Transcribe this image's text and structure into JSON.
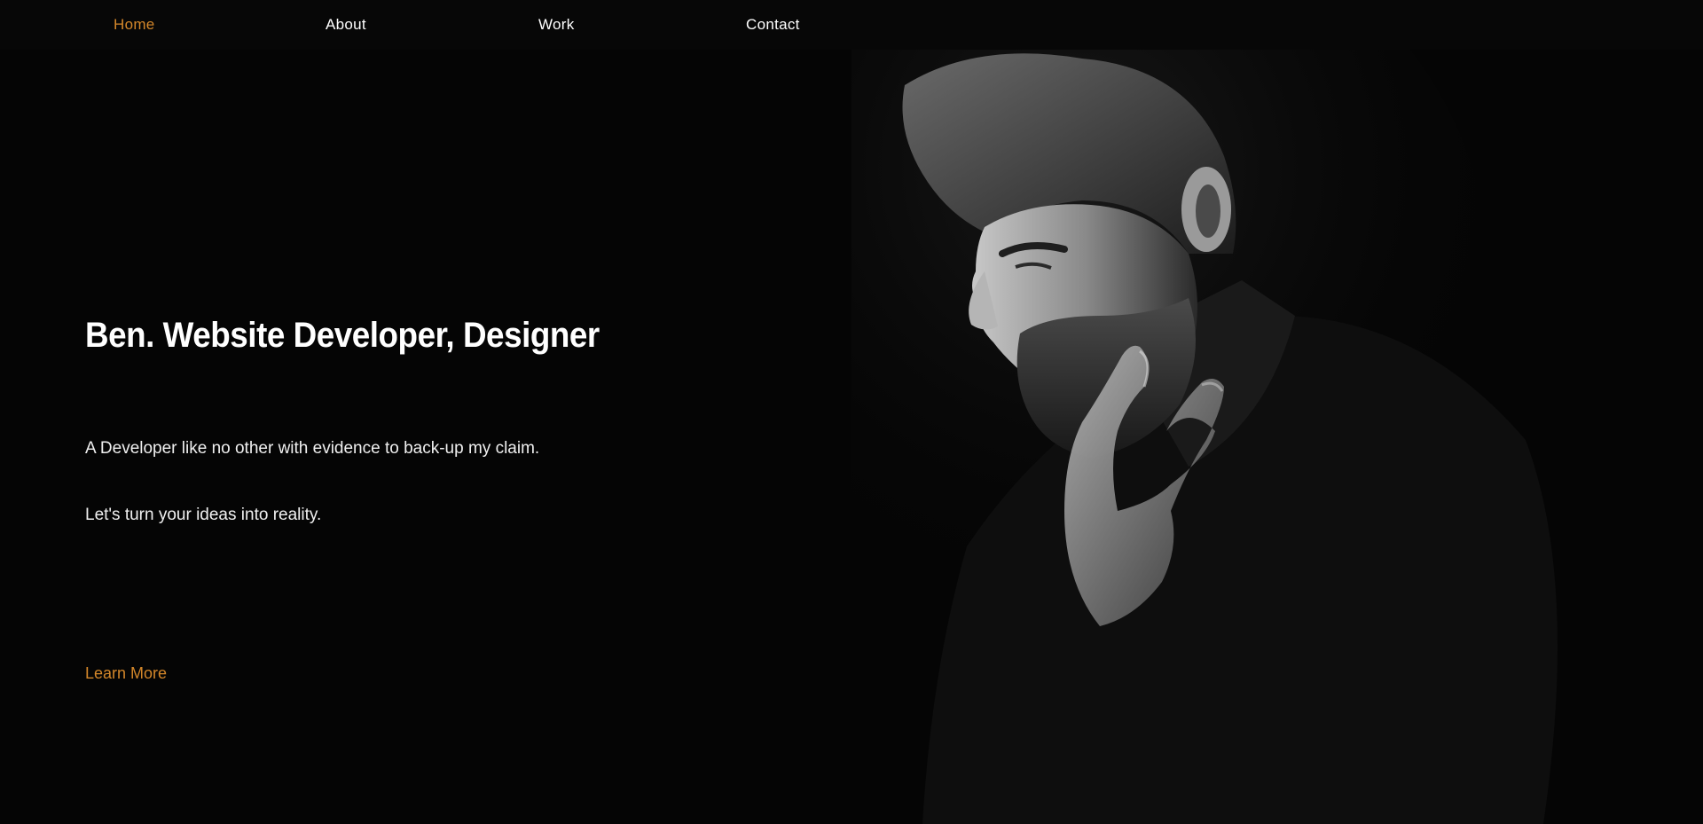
{
  "nav": {
    "items": [
      {
        "label": "Home",
        "active": true
      },
      {
        "label": "About",
        "active": false
      },
      {
        "label": "Work",
        "active": false
      },
      {
        "label": "Contact",
        "active": false
      }
    ]
  },
  "hero": {
    "title": "Ben. Website Developer, Designer",
    "line1": "A Developer like no other with evidence to back-up my claim.",
    "line2": "Let's turn your ideas into reality.",
    "cta": "Learn More"
  },
  "colors": {
    "background": "#050505",
    "accent": "#d4872a",
    "text": "#ffffff"
  }
}
